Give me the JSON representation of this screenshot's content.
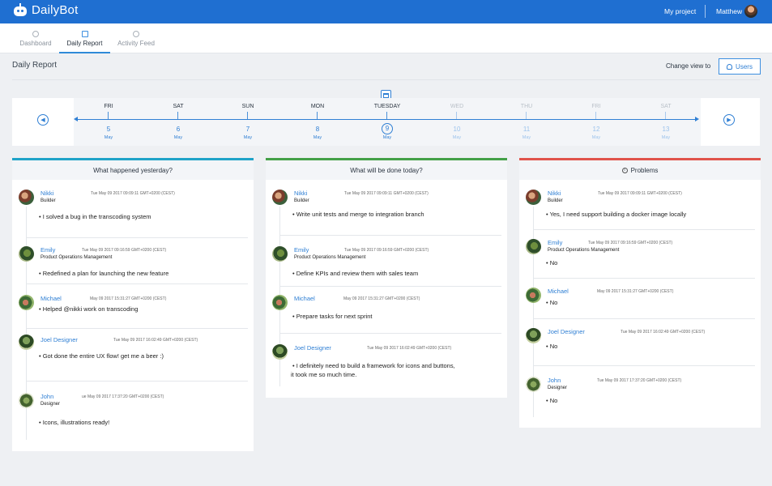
{
  "app": {
    "name": "DailyBot",
    "project": "My project",
    "user": "Matthew"
  },
  "tabs": [
    {
      "label": "Dashboard"
    },
    {
      "label": "Daily Report"
    },
    {
      "label": "Activity Feed"
    }
  ],
  "page": {
    "title": "Daily Report",
    "change_view": "Change view to",
    "users_button": "Users"
  },
  "timeline": {
    "days": [
      {
        "day": "FRI",
        "num": "5",
        "month": "May"
      },
      {
        "day": "SAT",
        "num": "6",
        "month": "May"
      },
      {
        "day": "SUN",
        "num": "7",
        "month": "May"
      },
      {
        "day": "MON",
        "num": "8",
        "month": "May"
      },
      {
        "day": "TUESDAY",
        "num": "9",
        "month": "May"
      },
      {
        "day": "WED",
        "num": "10",
        "month": "May"
      },
      {
        "day": "THU",
        "num": "11",
        "month": "May"
      },
      {
        "day": "FRI",
        "num": "12",
        "month": "May"
      },
      {
        "day": "SAT",
        "num": "13",
        "month": "May"
      }
    ]
  },
  "panels": [
    {
      "title": "What happened yesterday?",
      "accent": "#1fa3c8",
      "entries": [
        {
          "name": "Nikki",
          "time": "Tue May 09 2017 09:09:11 GMT+0200 (CEST)",
          "role": "Builder",
          "text": "• I solved a bug in the transcoding system"
        },
        {
          "name": "Emily",
          "time": "Tue May 09 2017 09:16:59 GMT+0200 (CEST)",
          "role": "Product Operations Management",
          "text": "• Redefined a plan for launching the new feature"
        },
        {
          "name": "Michael",
          "time": "May 09 2017 15:31:27 GMT+0200 (CEST)",
          "role": "",
          "text": "• Helped @nikki work on transcoding"
        },
        {
          "name": "Joel Designer",
          "time": "Tue May 09 2017 16:02:49 GMT+0200 (CEST)",
          "role": "",
          "text": "• Got done the entire UX flow! get me a beer :)"
        },
        {
          "name": "John",
          "time": "ue May 09 2017 17:37:20 GMT+0200 (CEST)",
          "role": "Designer",
          "text": "• Icons, illustrations ready!"
        }
      ]
    },
    {
      "title": "What will be done today?",
      "accent": "#43a047",
      "entries": [
        {
          "name": "Nikki",
          "time": "Tue May 09 2017 09:09:11 GMT+0200 (CEST)",
          "role": "Builder",
          "text": "• Write unit tests and merge to integration branch"
        },
        {
          "name": "Emily",
          "time": "Tue May 09 2017 09:16:59 GMT+0200 (CEST)",
          "role": "Product Operations Management",
          "text": "• Define KPIs and review them with sales team"
        },
        {
          "name": "Michael",
          "time": "May 09 2017 15:31:27 GMT+0200 (CEST)",
          "role": "",
          "text": "• Prepare tasks for next sprint"
        },
        {
          "name": "Joel Designer",
          "time": "Tue May 09 2017 16:02:49 GMT+0200 (CEST)",
          "role": "",
          "text": "• I definitely need to build a framework for icons and buttons,",
          "text2": "it took me so much time."
        }
      ]
    },
    {
      "title": "Problems",
      "accent": "#e0534a",
      "entries": [
        {
          "name": "Nikki",
          "time": "Tue May 09 2017 09:09:11 GMT+0200 (CEST)",
          "role": "Builder",
          "text": "• Yes, I need support building a docker image locally"
        },
        {
          "name": "Emily",
          "time": "Tue May 09 2017 09:16:59 GMT+0200 (CEST)",
          "role": "Product Operations Management",
          "text": "• No"
        },
        {
          "name": "Michael",
          "time": "May 09 2017 15:31:27 GMT+0200 (CEST)",
          "role": "",
          "text": "• No"
        },
        {
          "name": "Joel Designer",
          "time": "Tue May 09 2017 16:02:49 GMT+0200 (CEST)",
          "role": "",
          "text": "• No"
        },
        {
          "name": "John",
          "time": "Tue May 09 2017 17:37:20 GMT+0200 (CEST)",
          "role": "Designer",
          "text": "• No"
        }
      ]
    }
  ]
}
